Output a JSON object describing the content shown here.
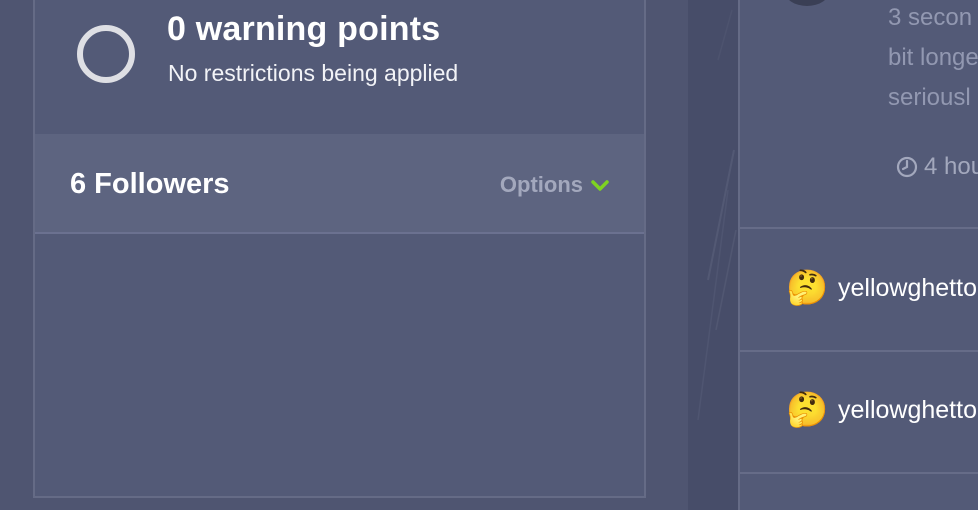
{
  "warning": {
    "title": "0 warning points",
    "subtitle": "No restrictions being applied"
  },
  "followers": {
    "title": "6 Followers",
    "options_label": "Options"
  },
  "right_panel": {
    "message_lines": [
      "3 secon",
      "bit longe",
      "seriousl"
    ],
    "time_label": "4 hou",
    "users": [
      {
        "emoji": "🤔",
        "name": "yellowghetto"
      },
      {
        "emoji": "🤔",
        "name": "yellowghetto"
      }
    ]
  },
  "colors": {
    "background": "#4f5571",
    "card": "#535a77",
    "followers_bar": "#5d6480",
    "options_chevron": "#7ed321",
    "muted_text": "#9298b1"
  }
}
